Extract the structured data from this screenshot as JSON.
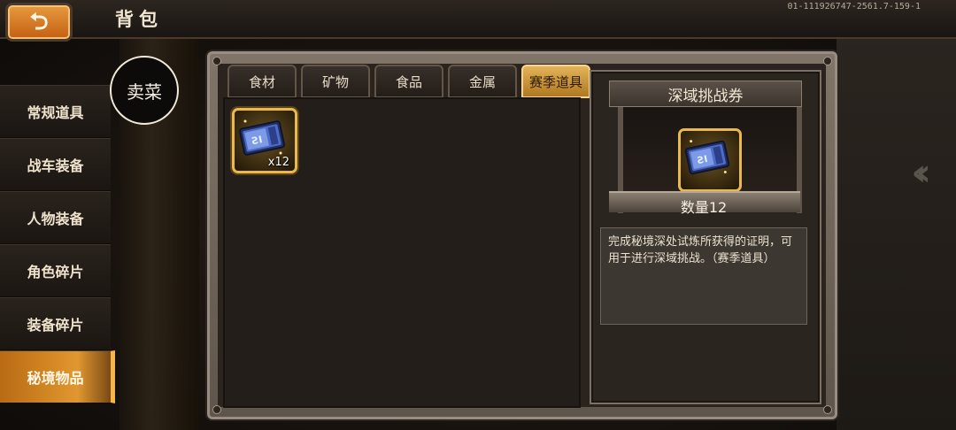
{
  "header": {
    "back_icon": "back-arrow-icon",
    "title": "背包",
    "build_info": "01-111926747-2561.7-159-1"
  },
  "sell_button": {
    "label": "卖菜"
  },
  "sidebar": {
    "items": [
      {
        "label": "常规道具",
        "active": false
      },
      {
        "label": "战车装备",
        "active": false
      },
      {
        "label": "人物装备",
        "active": false
      },
      {
        "label": "角色碎片",
        "active": false
      },
      {
        "label": "装备碎片",
        "active": false
      },
      {
        "label": "秘境物品",
        "active": true
      }
    ]
  },
  "tabs": [
    {
      "label": "食材",
      "active": false
    },
    {
      "label": "矿物",
      "active": false
    },
    {
      "label": "食品",
      "active": false
    },
    {
      "label": "金属",
      "active": false
    },
    {
      "label": "赛季道具",
      "active": true
    }
  ],
  "inventory": {
    "items": [
      {
        "icon": "ticket-icon",
        "quantity": "x12"
      }
    ]
  },
  "detail": {
    "name": "深域挑战券",
    "icon": "ticket-icon",
    "quantity_label": "数量12",
    "description": "完成秘境深处试炼所获得的证明，可用于进行深域挑战。（赛季道具）"
  },
  "colors": {
    "accent": "#e19730",
    "slot_border": "#e9b950",
    "panel": "#2a231e"
  }
}
